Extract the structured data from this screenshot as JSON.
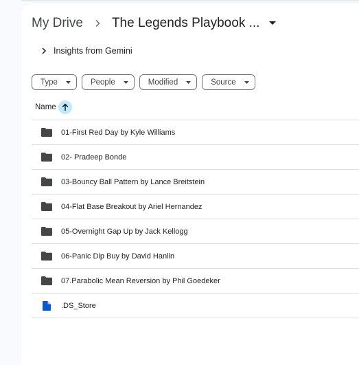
{
  "breadcrumb": {
    "root": "My Drive",
    "separator": "›",
    "current": "The Legends Playbook ...",
    "caret_icon": "arrow-drop-down-icon"
  },
  "insights": {
    "label": "Insights from Gemini",
    "icon": "chevron-right-icon"
  },
  "filters": [
    {
      "label": "Type"
    },
    {
      "label": "People"
    },
    {
      "label": "Modified"
    },
    {
      "label": "Source"
    }
  ],
  "list_header": {
    "name_label": "Name",
    "sort_icon": "arrow-upward-icon",
    "sort_bg": "#c2e7ff"
  },
  "items": [
    {
      "type": "folder",
      "name": "01-First Red Day by Kyle Williams"
    },
    {
      "type": "folder",
      "name": "02- Pradeep Bonde"
    },
    {
      "type": "folder",
      "name": "03-Bouncy Ball Pattern by Lance Breitstein"
    },
    {
      "type": "folder",
      "name": "04-Flat Base Breakout by Ariel Hernandez"
    },
    {
      "type": "folder",
      "name": "05-Overnight Gap Up by Jack Kellogg"
    },
    {
      "type": "folder",
      "name": "06-Panic Dip Buy by David Hanlin"
    },
    {
      "type": "folder",
      "name": "07.Parabolic Mean Reversion by Phil Goedeker"
    },
    {
      "type": "file",
      "name": ".DS_Store"
    }
  ],
  "colors": {
    "folder": "#444746",
    "file": "#0b57d0",
    "background": "#f8fafd"
  }
}
